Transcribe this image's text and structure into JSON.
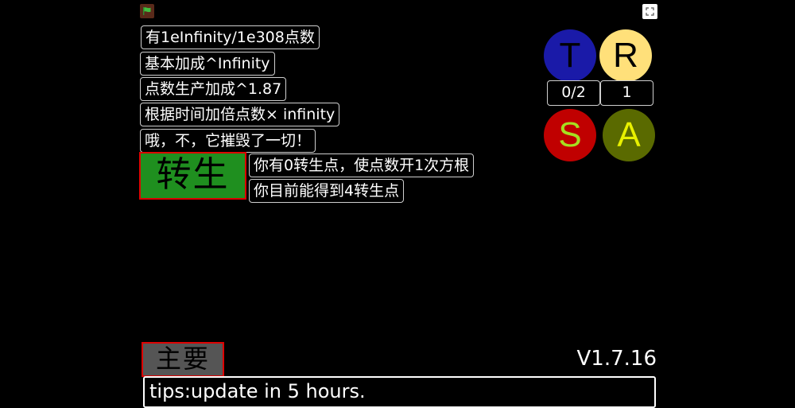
{
  "stage": {
    "green_flag": {
      "icon": "green-flag-icon",
      "color": "#3fbf3f"
    },
    "fullscreen": {
      "icon": "fullscreen-icon"
    }
  },
  "stats": {
    "line1": "有1eInfinity/1e308点数",
    "line2": "基本加成^Infinity",
    "line3": "点数生产加成^1.87",
    "line4": "根据时间加倍点数× infinity",
    "line5": "哦，不，它摧毁了一切！"
  },
  "rebirth": {
    "button_label": "转生",
    "info1": "你有0转生点，使点数开1次方根",
    "info2": "你目前能得到4转生点"
  },
  "layers": {
    "t": {
      "label": "T",
      "color": "#1a1aa8",
      "text_color": "#000000"
    },
    "r": {
      "label": "R",
      "color": "#ffe07a",
      "text_color": "#000000"
    },
    "s": {
      "label": "S",
      "color": "#c00000",
      "text_color": "#a6e020"
    },
    "a": {
      "label": "A",
      "color": "#5a6a00",
      "text_color": "#e8f000"
    },
    "t_counter": "0/2",
    "r_counter": "1"
  },
  "footer": {
    "main_label": "主要",
    "version": "V1.7.16",
    "tips": "tips:update in 5 hours."
  }
}
